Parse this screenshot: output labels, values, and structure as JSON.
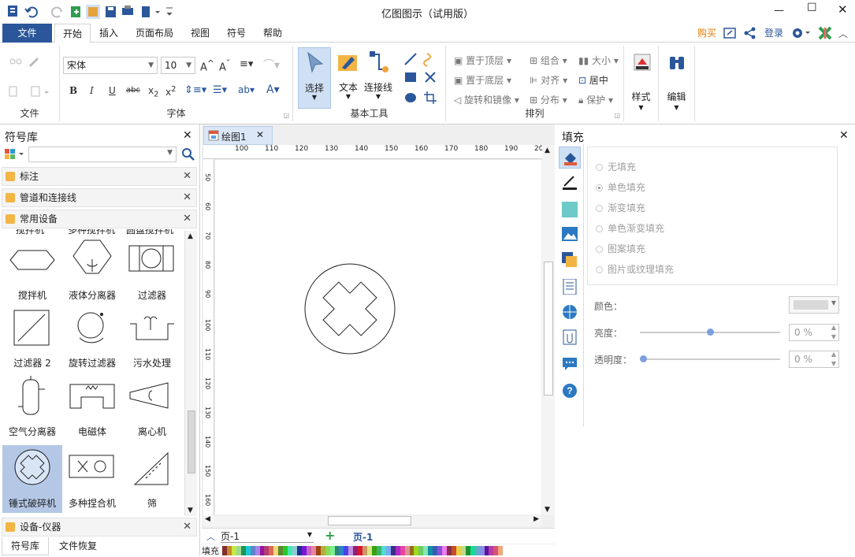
{
  "title": "亿图图示（试用版）",
  "menu": {
    "file": "文件",
    "home": "开始",
    "insert": "插入",
    "page_layout": "页面布局",
    "view": "视图",
    "symbol": "符号",
    "help": "帮助",
    "buy": "购买",
    "login": "登录"
  },
  "ribbon": {
    "file_group": "文件",
    "font_name": "宋体",
    "font_size": "10",
    "font_group": "字体",
    "select": "选择",
    "text": "文本",
    "connector": "连接线",
    "basic_tools": "基本工具",
    "bring_front": "置于顶层",
    "send_back": "置于底层",
    "rotate": "旋转和镜像",
    "combine": "组合",
    "align": "对齐",
    "distribute": "分布",
    "size": "大小",
    "center": "居中",
    "protect": "保护",
    "arrange": "排列",
    "style": "样式",
    "edit": "编辑"
  },
  "library": {
    "title": "符号库",
    "categories": [
      "标注",
      "管道和连接线",
      "常用设备"
    ],
    "partial_labels": [
      "搅拌机",
      "多种搅拌机",
      "圆盘搅拌机"
    ],
    "symbols": [
      "搅拌机",
      "液体分离器",
      "过滤器",
      "过滤器 2",
      "旋转过滤器",
      "污水处理",
      "空气分离器",
      "电磁体",
      "离心机",
      "锤式破碎机",
      "多种捏合机",
      "筛"
    ],
    "bottom_category": "设备-仪器",
    "tab_library": "符号库",
    "tab_recovery": "文件恢复"
  },
  "canvas": {
    "doc_tab": "绘图1",
    "page_select": "页-1",
    "page_tab": "页-1",
    "fill_label": "填充",
    "ruler_h": [
      "100",
      "110",
      "120",
      "130",
      "140",
      "150",
      "160",
      "170",
      "180",
      "190",
      "20"
    ],
    "ruler_v": [
      "50",
      "60",
      "70",
      "80",
      "90",
      "100",
      "110",
      "120",
      "130",
      "140",
      "150",
      "160"
    ]
  },
  "fill": {
    "title": "填充",
    "options": [
      "无填充",
      "单色填充",
      "渐变填充",
      "单色渐变填充",
      "图案填充",
      "图片或纹理填充"
    ],
    "selected": "单色填充",
    "color_label": "颜色：",
    "brightness_label": "亮度：",
    "brightness_value": "0 %",
    "transparency_label": "透明度：",
    "transparency_value": "0 %",
    "brightness_level": 0.5,
    "transparency_level": 0.0
  },
  "colors": {
    "accent": "#2b579a",
    "tab_active": "#ffffff",
    "selected_symbol": "#b4c8e6"
  }
}
